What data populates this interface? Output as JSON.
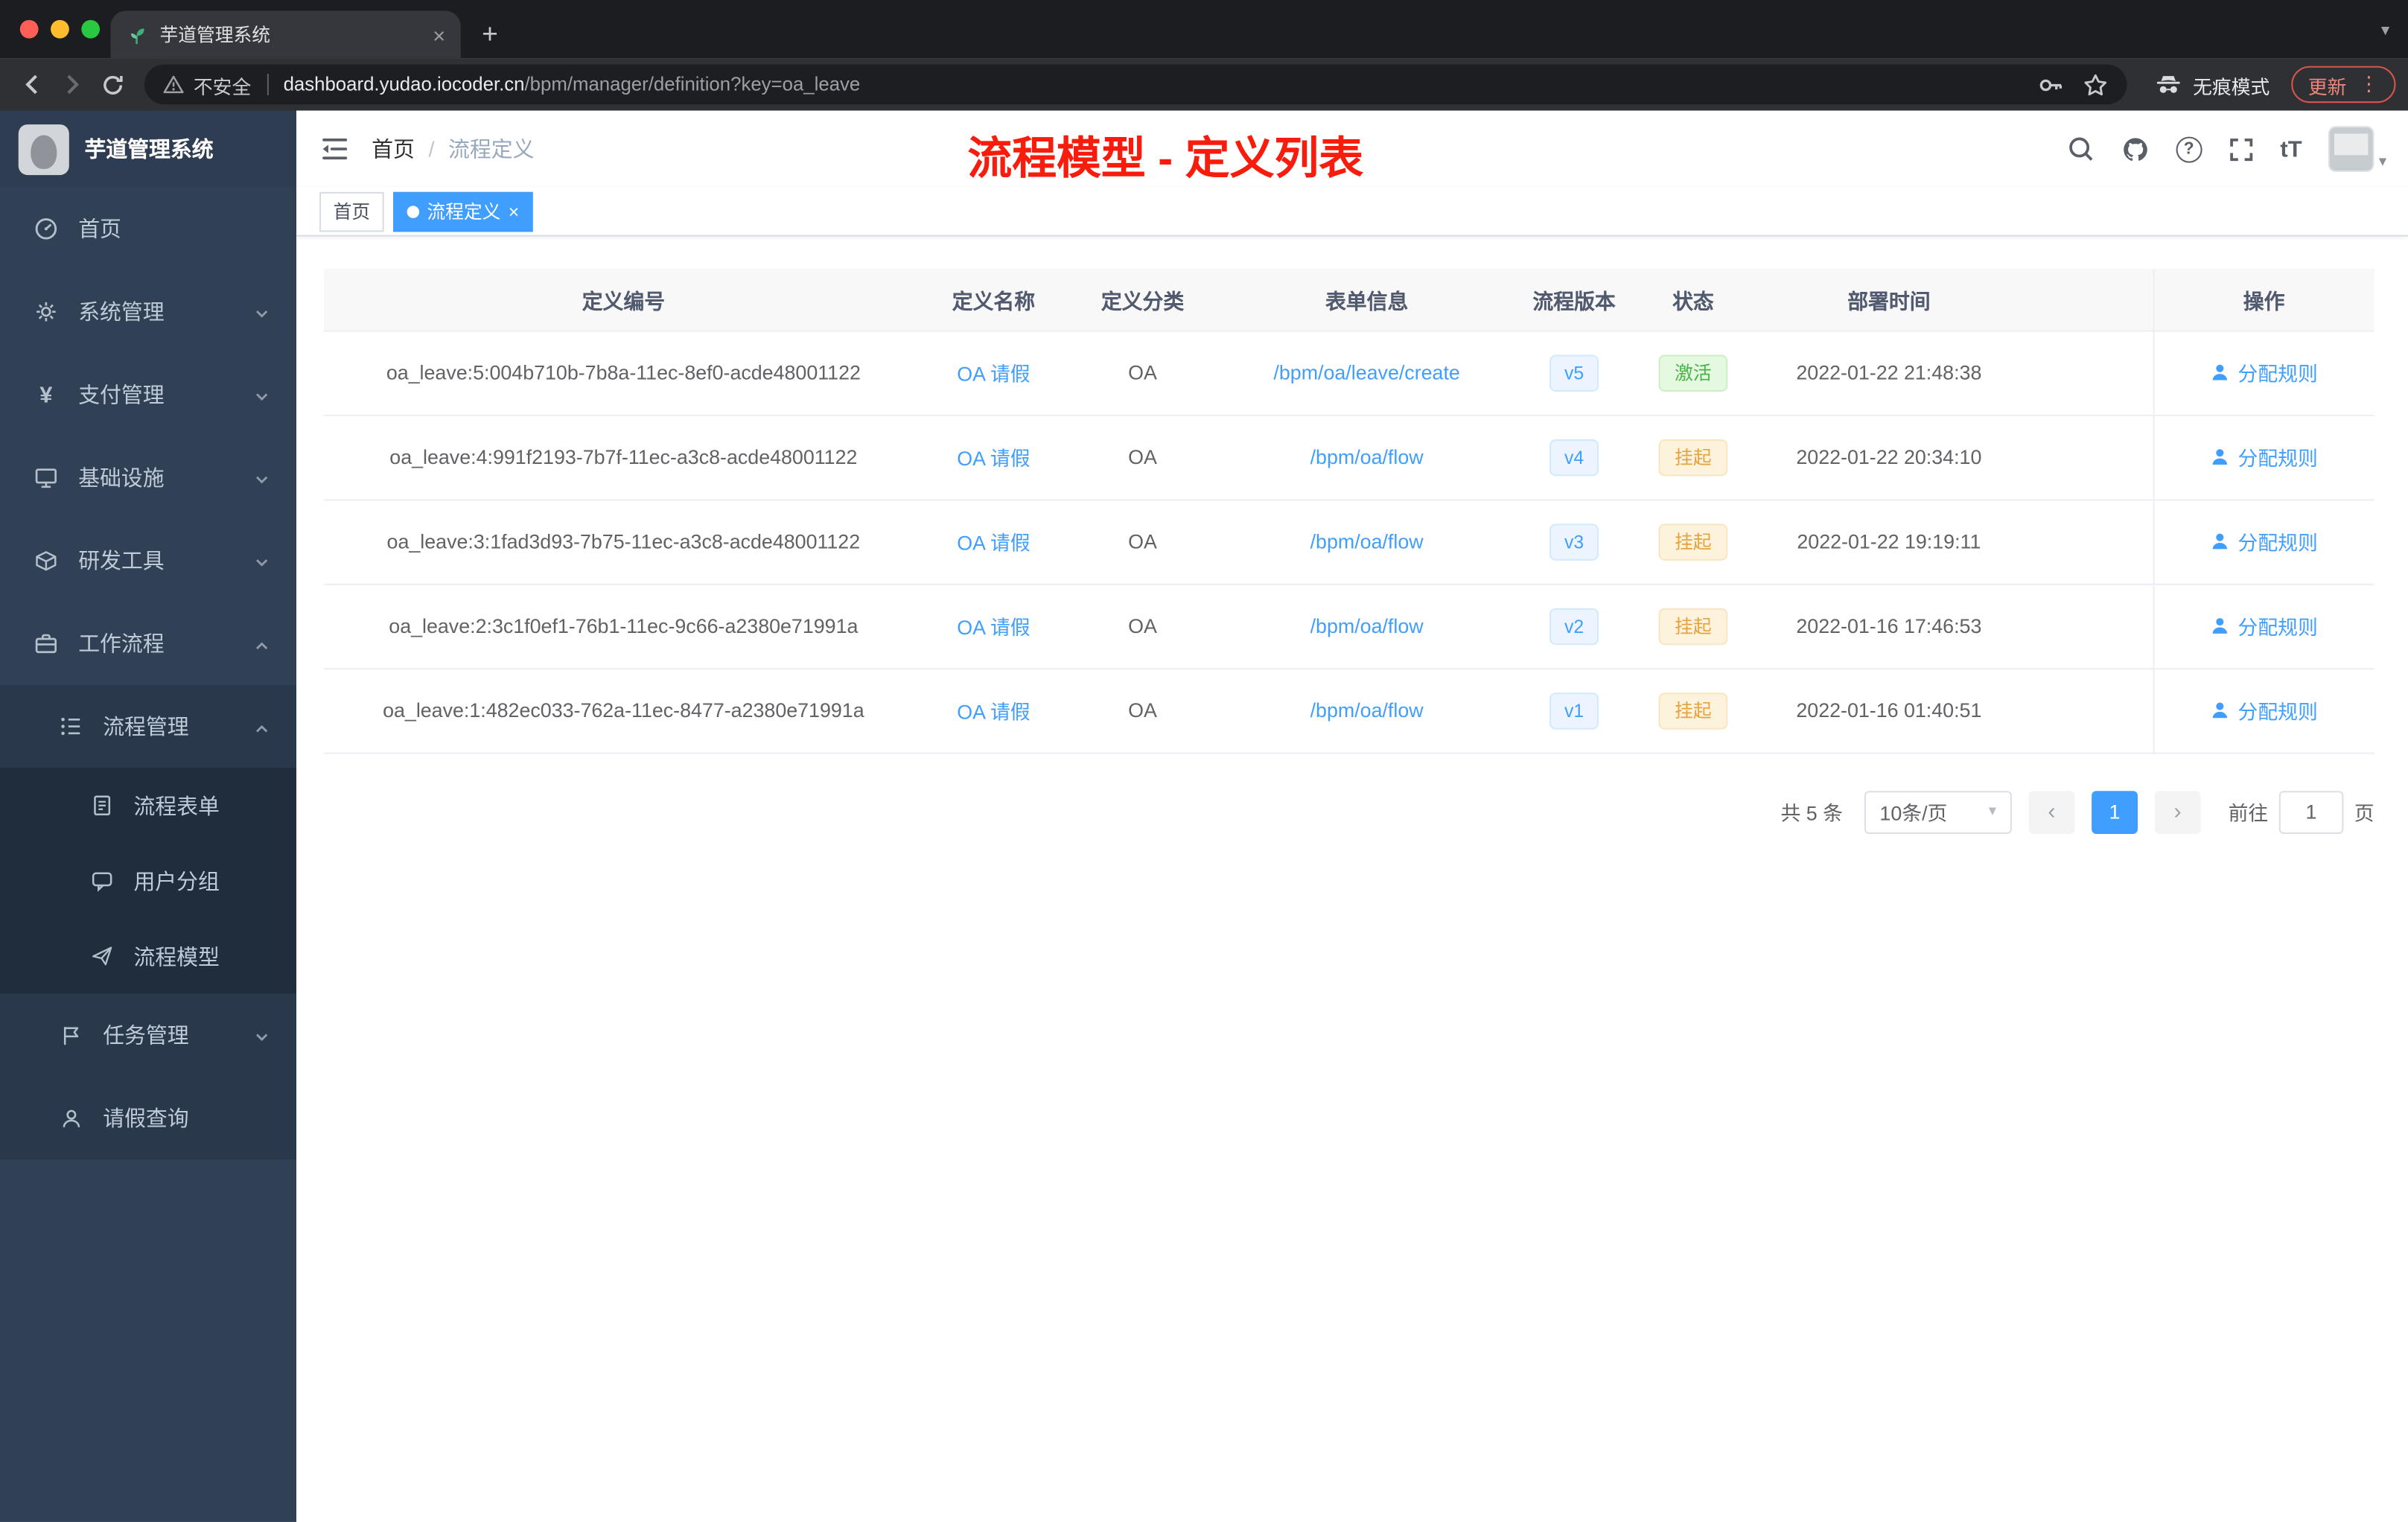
{
  "icons": {
    "close": "×",
    "plus": "+",
    "caret_down": "▾",
    "help": "?",
    "dots": "⋮",
    "chevron_left": "‹",
    "chevron_right": "›",
    "yen": "¥",
    "font_size": "tT"
  },
  "browser": {
    "tab_title": "芋道管理系统",
    "security_label": "不安全",
    "url_host": "dashboard.yudao.iocoder.cn",
    "url_path": "/bpm/manager/definition?key=oa_leave",
    "profile_label": "无痕模式",
    "update_label": "更新"
  },
  "app": {
    "logo_title": "芋道管理系统",
    "sidebar": [
      {
        "label": "首页"
      },
      {
        "label": "系统管理"
      },
      {
        "label": "支付管理"
      },
      {
        "label": "基础设施"
      },
      {
        "label": "研发工具"
      },
      {
        "label": "工作流程"
      },
      {
        "label": "流程管理"
      },
      {
        "label": "流程表单"
      },
      {
        "label": "用户分组"
      },
      {
        "label": "流程模型"
      },
      {
        "label": "任务管理"
      },
      {
        "label": "请假查询"
      }
    ],
    "breadcrumb": {
      "home": "首页",
      "separator": "/",
      "current": "流程定义"
    },
    "annotation": "流程模型 - 定义列表",
    "tags": [
      {
        "label": "首页"
      },
      {
        "label": "流程定义"
      }
    ]
  },
  "table": {
    "headers": [
      "定义编号",
      "定义名称",
      "定义分类",
      "表单信息",
      "流程版本",
      "状态",
      "部署时间",
      "操作"
    ],
    "rows": [
      {
        "id": "oa_leave:5:004b710b-7b8a-11ec-8ef0-acde48001122",
        "name": "OA 请假",
        "category": "OA",
        "form": "/bpm/oa/leave/create",
        "version": "v5",
        "status": "激活",
        "status_type": "success",
        "time": "2022-01-22 21:48:38",
        "action": "分配规则"
      },
      {
        "id": "oa_leave:4:991f2193-7b7f-11ec-a3c8-acde48001122",
        "name": "OA 请假",
        "category": "OA",
        "form": "/bpm/oa/flow",
        "version": "v4",
        "status": "挂起",
        "status_type": "warning",
        "time": "2022-01-22 20:34:10",
        "action": "分配规则"
      },
      {
        "id": "oa_leave:3:1fad3d93-7b75-11ec-a3c8-acde48001122",
        "name": "OA 请假",
        "category": "OA",
        "form": "/bpm/oa/flow",
        "version": "v3",
        "status": "挂起",
        "status_type": "warning",
        "time": "2022-01-22 19:19:11",
        "action": "分配规则"
      },
      {
        "id": "oa_leave:2:3c1f0ef1-76b1-11ec-9c66-a2380e71991a",
        "name": "OA 请假",
        "category": "OA",
        "form": "/bpm/oa/flow",
        "version": "v2",
        "status": "挂起",
        "status_type": "warning",
        "time": "2022-01-16 17:46:53",
        "action": "分配规则"
      },
      {
        "id": "oa_leave:1:482ec033-762a-11ec-8477-a2380e71991a",
        "name": "OA 请假",
        "category": "OA",
        "form": "/bpm/oa/flow",
        "version": "v1",
        "status": "挂起",
        "status_type": "warning",
        "time": "2022-01-16 01:40:51",
        "action": "分配规则"
      }
    ]
  },
  "pagination": {
    "total": "共 5 条",
    "page_size": "10条/页",
    "current_page": "1",
    "goto_label": "前往",
    "goto_value": "1",
    "unit_label": "页"
  },
  "colors": {
    "accent": "#409eff",
    "sidebar_bg": "#304156",
    "success": "#48b348",
    "warning": "#e6a23c",
    "annotation_red": "#f81c0c",
    "active_tag_bg": "#409eff"
  }
}
